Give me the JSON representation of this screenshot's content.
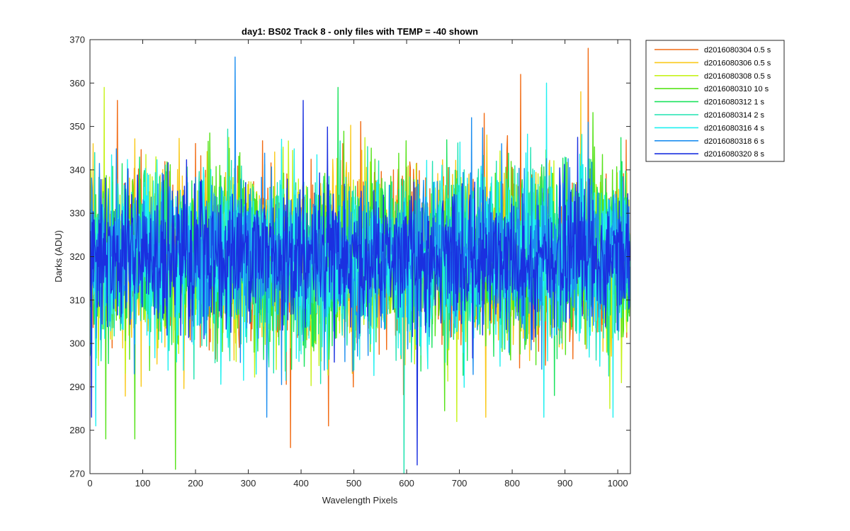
{
  "chart_data": {
    "type": "line",
    "title": "day1: BS02  Track 8 - only files with TEMP = -40 shown",
    "xlabel": "Wavelength Pixels",
    "ylabel": "Darks (ADU)",
    "xlim": [
      0,
      1024
    ],
    "ylim": [
      270,
      370
    ],
    "xticks": [
      0,
      100,
      200,
      300,
      400,
      500,
      600,
      700,
      800,
      900,
      1000
    ],
    "yticks": [
      270,
      280,
      290,
      300,
      310,
      320,
      330,
      340,
      350,
      360,
      370
    ],
    "xtick_labels": [
      "0",
      "100",
      "200",
      "300",
      "400",
      "500",
      "600",
      "700",
      "800",
      "900",
      "1000"
    ],
    "ytick_labels": [
      "270",
      "280",
      "290",
      "300",
      "310",
      "320",
      "330",
      "340",
      "350",
      "360",
      "370"
    ],
    "grid": false,
    "legend_position": "outside-top-right",
    "series": [
      {
        "name": "d2016080304 0.5 s",
        "color": "#f26b13",
        "mean": 320,
        "sd": 10,
        "num_points": 1024,
        "extrema": [
          [
            52,
            356
          ],
          [
            380,
            276
          ],
          [
            816,
            362
          ],
          [
            944,
            368
          ]
        ]
      },
      {
        "name": "d2016080306 0.5 s",
        "color": "#fac919",
        "mean": 320,
        "sd": 10,
        "num_points": 1024,
        "extrema": [
          [
            750,
            283
          ],
          [
            930,
            358
          ]
        ]
      },
      {
        "name": "d2016080308 0.5 s",
        "color": "#c7f21b",
        "mean": 320,
        "sd": 10,
        "num_points": 1024,
        "extrema": [
          [
            695,
            282
          ],
          [
            985,
            285
          ]
        ]
      },
      {
        "name": "d2016080310 10 s",
        "color": "#57e31a",
        "mean": 320,
        "sd": 10,
        "num_points": 1024,
        "extrema": [
          [
            162,
            271
          ],
          [
            30,
            278
          ],
          [
            85,
            278
          ]
        ]
      },
      {
        "name": "d2016080312 1 s",
        "color": "#1be35e",
        "mean": 320,
        "sd": 10,
        "num_points": 1024,
        "extrema": [
          [
            470,
            359
          ],
          [
            880,
            288
          ]
        ]
      },
      {
        "name": "d2016080314 2 s",
        "color": "#1fe3b0",
        "mean": 320,
        "sd": 10,
        "num_points": 1024,
        "extrema": [
          [
            595,
            270
          ]
        ]
      },
      {
        "name": "d2016080316 4 s",
        "color": "#1ff0f0",
        "mean": 320,
        "sd": 10,
        "num_points": 1024,
        "extrema": [
          [
            865,
            360
          ],
          [
            860,
            283
          ]
        ]
      },
      {
        "name": "d2016080318 6 s",
        "color": "#1c8ef0",
        "mean": 320,
        "sd": 9,
        "num_points": 1024,
        "extrema": [
          [
            275,
            366
          ],
          [
            335,
            283
          ]
        ]
      },
      {
        "name": "d2016080320 8 s",
        "color": "#1a30e0",
        "mean": 320,
        "sd": 8,
        "num_points": 1024,
        "extrema": [
          [
            620,
            272
          ],
          [
            404,
            356
          ],
          [
            3,
            283
          ]
        ]
      }
    ]
  }
}
